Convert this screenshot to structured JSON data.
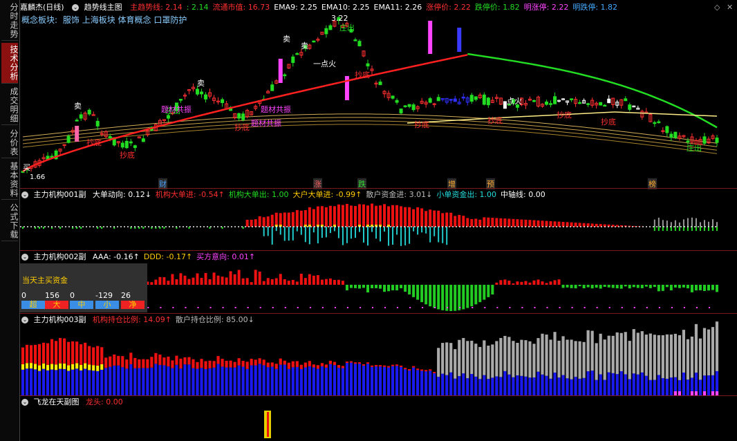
{
  "sidebar": {
    "tabs": [
      {
        "label": "分时走势",
        "active": false
      },
      {
        "label": "技术分析",
        "active": true
      },
      {
        "label": "成交明细",
        "active": false
      },
      {
        "label": "分价表",
        "active": false
      },
      {
        "label": "基本资料",
        "active": false
      },
      {
        "label": "公式下载",
        "active": false
      }
    ]
  },
  "header": {
    "stock": "嘉麟杰(日线)",
    "indicator": "趋势线主图",
    "items": [
      {
        "label": "主趋势线: 2.14",
        "color": "#ff3030"
      },
      {
        "label": ": 2.14",
        "color": "#22dd22"
      },
      {
        "label": "流通市值: 16.73",
        "color": "#ff3030"
      },
      {
        "label": "EMA9: 2.25",
        "color": "#ffffff"
      },
      {
        "label": "EMA10: 2.25",
        "color": "#ffffff"
      },
      {
        "label": "EMA11: 2.26",
        "color": "#ffffff"
      },
      {
        "label": "涨停价: 2.22",
        "color": "#ff3030"
      },
      {
        "label": "跌停价: 1.82",
        "color": "#22dd22"
      },
      {
        "label": "明涨停: 2.22",
        "color": "#ff44ff"
      },
      {
        "label": "明跌停: 1.82",
        "color": "#44aaff"
      }
    ],
    "concept_label": "概念板块:",
    "concept_value": "服饰 上海板块 体育概念 口罩防护"
  },
  "main_chart": {
    "price_high": "3.22",
    "price_low": "1.66",
    "markers": [
      {
        "text": "卖",
        "color": "#ffffff"
      },
      {
        "text": "卖",
        "color": "#ffffff"
      },
      {
        "text": "卖",
        "color": "#ffffff"
      },
      {
        "text": "卖",
        "color": "#ffffff"
      },
      {
        "text": "抄底",
        "color": "#ff3030"
      },
      {
        "text": "抄底",
        "color": "#ff3030"
      },
      {
        "text": "抄底",
        "color": "#ff3030"
      },
      {
        "text": "抄底",
        "color": "#ff3030"
      },
      {
        "text": "抄底",
        "color": "#ff3030"
      },
      {
        "text": "抄底",
        "color": "#ff3030"
      },
      {
        "text": "抄底",
        "color": "#ff3030"
      },
      {
        "text": "抄底",
        "color": "#ff3030"
      },
      {
        "text": "庄出",
        "color": "#22dd22"
      },
      {
        "text": "庄出",
        "color": "#22dd22"
      },
      {
        "text": "庄出",
        "color": "#22dd22"
      },
      {
        "text": "题材共振",
        "color": "#ff44ff"
      },
      {
        "text": "题材共振",
        "color": "#ff44ff"
      },
      {
        "text": "题材共振",
        "color": "#ff44ff"
      },
      {
        "text": "一点火",
        "color": "#ffffff"
      },
      {
        "text": "点火",
        "color": "#ffffff"
      },
      {
        "text": "买",
        "color": "#ffffff"
      }
    ],
    "event_tags": [
      {
        "text": "财",
        "color": "#4aa0ff"
      },
      {
        "text": "涨",
        "color": "#ff6060"
      },
      {
        "text": "跌",
        "color": "#33dd33"
      },
      {
        "text": "增",
        "color": "#ffaa33"
      },
      {
        "text": "预",
        "color": "#ffaa33"
      },
      {
        "text": "榜",
        "color": "#ffaa33"
      }
    ]
  },
  "panel1": {
    "name": "主力机构001副",
    "items": [
      {
        "label": "大单动向: 0.12↓",
        "color": "#ffffff"
      },
      {
        "label": "机构大单进: -0.54↑",
        "color": "#ff3030"
      },
      {
        "label": "机构大单出: 1.00",
        "color": "#22dd22"
      },
      {
        "label": "大户大单进: -0.99↑",
        "color": "#ffcc00"
      },
      {
        "label": "散户资金进: 3.01↓",
        "color": "#bbbbbb"
      },
      {
        "label": "小单资金出: 1.00",
        "color": "#22dddd"
      },
      {
        "label": "中轴线: 0.00",
        "color": "#ffffff"
      }
    ]
  },
  "panel2": {
    "name": "主力机构002副",
    "items": [
      {
        "label": "AAA: -0.16↑",
        "color": "#ffffff"
      },
      {
        "label": "DDD: -0.17↑",
        "color": "#ffcc00"
      },
      {
        "label": "买方意向: 0.01↑",
        "color": "#ff44ff"
      }
    ],
    "daily_box": {
      "title": "当天主买资金",
      "cells": [
        {
          "value": "0",
          "label": "超",
          "color": "#3a8ee6"
        },
        {
          "value": "156",
          "label": "大",
          "color": "#ee2222"
        },
        {
          "value": "0",
          "label": "中",
          "color": "#3a8ee6"
        },
        {
          "value": "-129",
          "label": "小",
          "color": "#3a8ee6"
        },
        {
          "value": "26",
          "label": "净",
          "color": "#ee2222"
        }
      ]
    }
  },
  "panel3": {
    "name": "主力机构003副",
    "items": [
      {
        "label": "机构持仓比例: 14.09↑",
        "color": "#ff3030"
      },
      {
        "label": "散户持仓比例: 85.00↓",
        "color": "#bbbbbb"
      }
    ]
  },
  "panel4": {
    "name": "飞龙在天副图",
    "items": [
      {
        "label": "龙头: 0.00",
        "color": "#ff3030"
      }
    ]
  }
}
